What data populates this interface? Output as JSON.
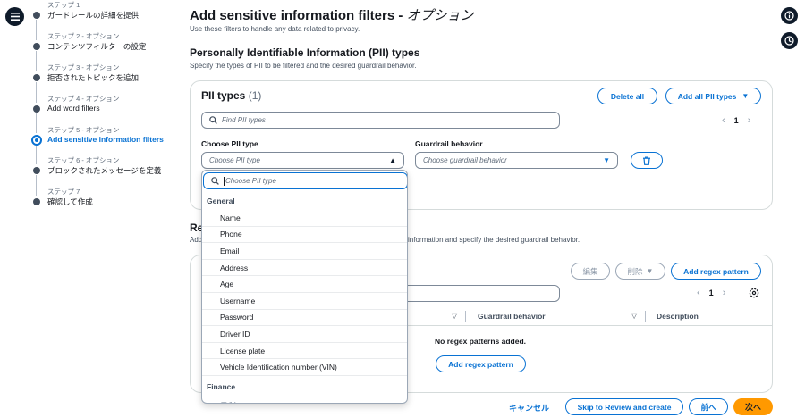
{
  "nav": {
    "steps": [
      {
        "num": "ステップ 1",
        "label": "ガードレールの詳細を提供",
        "active": false
      },
      {
        "num": "ステップ 2 - オプション",
        "label": "コンテンツフィルターの設定",
        "active": false
      },
      {
        "num": "ステップ 3 - オプション",
        "label": "拒否されたトピックを追加",
        "active": false
      },
      {
        "num": "ステップ 4 - オプション",
        "label": "Add word filters",
        "active": false
      },
      {
        "num": "ステップ 5 - オプション",
        "label": "Add sensitive information filters",
        "active": true
      },
      {
        "num": "ステップ 6 - オプション",
        "label": "ブロックされたメッセージを定義",
        "active": false
      },
      {
        "num": "ステップ 7",
        "label": "確認して作成",
        "active": false
      }
    ]
  },
  "page": {
    "title": "Add sensitive information filters - ",
    "title_suffix": "オプション",
    "description": "Use these filters to handle any data related to privacy."
  },
  "pii_section": {
    "title": "Personally Identifiable Information (PII) types",
    "description": "Specify the types of PII to be filtered and the desired guardrail behavior.",
    "panel_title": "PII types",
    "count": "(1)",
    "delete_all": "Delete all",
    "add_all": "Add all PII types",
    "search_placeholder": "Find PII types",
    "page_number": "1",
    "choose_label": "Choose PII type",
    "choose_placeholder": "Choose PII type",
    "behavior_label": "Guardrail behavior",
    "behavior_placeholder": "Choose guardrail behavior"
  },
  "dropdown": {
    "search_placeholder": "Choose PII type",
    "groups": [
      {
        "label": "General",
        "items": [
          "Name",
          "Phone",
          "Email",
          "Address",
          "Age",
          "Username",
          "Password",
          "Driver ID",
          "License plate",
          "Vehicle Identification number (VIN)"
        ]
      },
      {
        "label": "Finance",
        "items": [
          "CVV"
        ]
      }
    ]
  },
  "regex_section": {
    "title_visible": "Re",
    "desc_visible": "Add",
    "desc_tail": "information and specify the desired guardrail behavior.",
    "edit": "編集",
    "delete": "削除",
    "add_pattern": "Add regex pattern",
    "page_number": "1",
    "col_behavior": "Guardrail behavior",
    "col_description": "Description",
    "empty_message": "No regex patterns added.",
    "empty_add": "Add regex pattern"
  },
  "footer": {
    "cancel": "キャンセル",
    "skip": "Skip to Review and create",
    "prev": "前へ",
    "next": "次へ"
  },
  "colors": {
    "accent": "#0972d3",
    "primary_button": "#ff9900",
    "dark": "#0f1b2a"
  }
}
